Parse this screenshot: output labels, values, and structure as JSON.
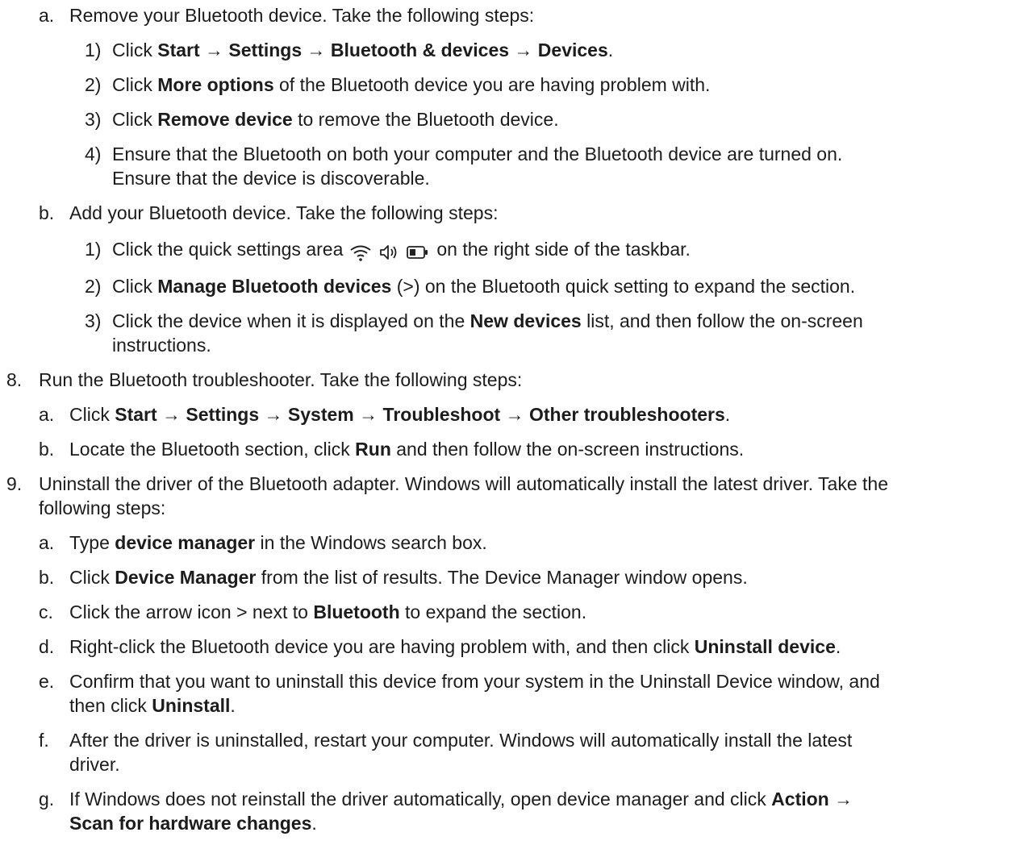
{
  "lines": [
    {
      "marker": "a.",
      "parts": [
        {
          "t": "Remove your Bluetooth device. Take the following steps:",
          "b": false
        }
      ]
    },
    {
      "marker": "1)",
      "parts": [
        {
          "t": "Click ",
          "b": false
        },
        {
          "t": "Start → Settings → Bluetooth & devices → Devices",
          "b": true
        },
        {
          "t": ".",
          "b": false
        }
      ]
    },
    {
      "marker": "2)",
      "parts": [
        {
          "t": "Click ",
          "b": false
        },
        {
          "t": "More options",
          "b": true
        },
        {
          "t": " of the Bluetooth device you are having problem with.",
          "b": false
        }
      ]
    },
    {
      "marker": "3)",
      "parts": [
        {
          "t": "Click ",
          "b": false
        },
        {
          "t": "Remove device",
          "b": true
        },
        {
          "t": " to remove the Bluetooth device.",
          "b": false
        }
      ]
    },
    {
      "marker": "4)",
      "parts": [
        {
          "t": "Ensure that the Bluetooth on both your computer and the Bluetooth device are turned on.",
          "b": false
        }
      ]
    },
    {
      "marker": "",
      "parts": [
        {
          "t": "Ensure that the device is discoverable.",
          "b": false
        }
      ]
    },
    {
      "marker": "b.",
      "parts": [
        {
          "t": "Add your Bluetooth device. Take the following steps:",
          "b": false
        }
      ]
    },
    {
      "marker": "1)",
      "parts": [
        {
          "t": "Click the quick settings area",
          "b": false
        },
        {
          "icons": [
            "wifi-icon",
            "speaker-icon",
            "battery-icon"
          ]
        },
        {
          "t": "on the right side of the taskbar.",
          "b": false
        }
      ]
    },
    {
      "marker": "2)",
      "parts": [
        {
          "t": "Click ",
          "b": false
        },
        {
          "t": "Manage Bluetooth devices",
          "b": true
        },
        {
          "t": " (>) on the Bluetooth quick setting to expand the section.",
          "b": false
        }
      ]
    },
    {
      "marker": "3)",
      "parts": [
        {
          "t": "Click the device when it is displayed on the ",
          "b": false
        },
        {
          "t": "New devices",
          "b": true
        },
        {
          "t": " list, and then follow the on-screen",
          "b": false
        }
      ]
    },
    {
      "marker": "",
      "parts": [
        {
          "t": "instructions.",
          "b": false
        }
      ]
    },
    {
      "marker": "8.",
      "parts": [
        {
          "t": "Run the Bluetooth troubleshooter. Take the following steps:",
          "b": false
        }
      ]
    },
    {
      "marker": "a.",
      "parts": [
        {
          "t": "Click ",
          "b": false
        },
        {
          "t": "Start → Settings → System → Troubleshoot → Other troubleshooters",
          "b": true
        },
        {
          "t": ".",
          "b": false
        }
      ]
    },
    {
      "marker": "b.",
      "parts": [
        {
          "t": "Locate the Bluetooth section, click ",
          "b": false
        },
        {
          "t": "Run",
          "b": true
        },
        {
          "t": " and then follow the on-screen instructions.",
          "b": false
        }
      ]
    },
    {
      "marker": "9.",
      "parts": [
        {
          "t": "Uninstall the driver of the Bluetooth adapter. Windows will automatically install the latest driver. Take the",
          "b": false
        }
      ]
    },
    {
      "marker": "",
      "parts": [
        {
          "t": "following steps:",
          "b": false
        }
      ]
    },
    {
      "marker": "a.",
      "parts": [
        {
          "t": "Type ",
          "b": false
        },
        {
          "t": "device manager",
          "b": true
        },
        {
          "t": " in the Windows search box.",
          "b": false
        }
      ]
    },
    {
      "marker": "b.",
      "parts": [
        {
          "t": "Click ",
          "b": false
        },
        {
          "t": "Device Manager",
          "b": true
        },
        {
          "t": " from the list of results. The Device Manager window opens.",
          "b": false
        }
      ]
    },
    {
      "marker": "c.",
      "parts": [
        {
          "t": "Click the arrow icon > next to ",
          "b": false
        },
        {
          "t": "Bluetooth",
          "b": true
        },
        {
          "t": " to expand the section.",
          "b": false
        }
      ]
    },
    {
      "marker": "d.",
      "parts": [
        {
          "t": "Right-click the Bluetooth device you are having problem with, and then click ",
          "b": false
        },
        {
          "t": "Uninstall device",
          "b": true
        },
        {
          "t": ".",
          "b": false
        }
      ]
    },
    {
      "marker": "e.",
      "parts": [
        {
          "t": "Confirm that you want to uninstall this device from your system in the Uninstall Device window, and",
          "b": false
        }
      ]
    },
    {
      "marker": "",
      "parts": [
        {
          "t": "then click ",
          "b": false
        },
        {
          "t": "Uninstall",
          "b": true
        },
        {
          "t": ".",
          "b": false
        }
      ]
    },
    {
      "marker": "f.",
      "parts": [
        {
          "t": "After the driver is uninstalled, restart your computer. Windows will automatically install the latest",
          "b": false
        }
      ]
    },
    {
      "marker": "",
      "parts": [
        {
          "t": "driver.",
          "b": false
        }
      ]
    },
    {
      "marker": "g.",
      "parts": [
        {
          "t": "If Windows does not reinstall the driver automatically, open device manager and click ",
          "b": false
        },
        {
          "t": "Action →",
          "b": true
        }
      ]
    },
    {
      "marker": "",
      "parts": [
        {
          "t": "Scan for hardware changes",
          "b": true
        },
        {
          "t": ".",
          "b": false
        }
      ]
    }
  ]
}
